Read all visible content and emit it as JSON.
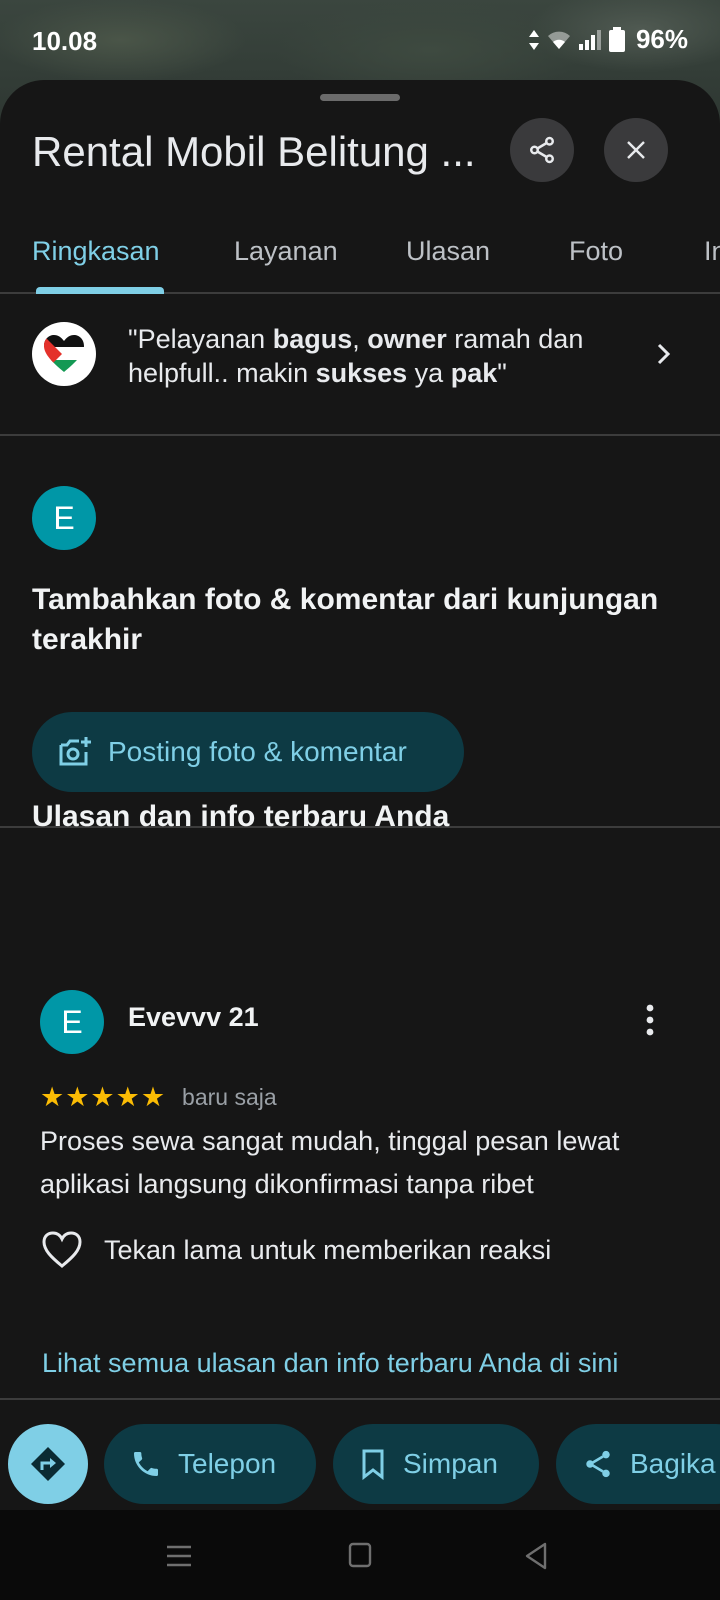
{
  "status_bar": {
    "time": "10.08",
    "battery": "96%"
  },
  "place": {
    "title": "Rental Mobil Belitung ..."
  },
  "tabs": [
    {
      "label": "Ringkasan",
      "active": true
    },
    {
      "label": "Layanan",
      "active": false
    },
    {
      "label": "Ulasan",
      "active": false
    },
    {
      "label": "Foto",
      "active": false
    },
    {
      "label": "In",
      "active": false
    }
  ],
  "highlight_quote": {
    "parts": [
      {
        "text": "\"Pelayanan ",
        "bold": false
      },
      {
        "text": "bagus",
        "bold": true
      },
      {
        "text": ", ",
        "bold": false
      },
      {
        "text": "owner",
        "bold": true
      },
      {
        "text": " ramah dan helpfull.. makin ",
        "bold": false
      },
      {
        "text": "sukses",
        "bold": true
      },
      {
        "text": " ya ",
        "bold": false
      },
      {
        "text": "pak",
        "bold": true
      },
      {
        "text": "\"",
        "bold": false
      }
    ]
  },
  "add_contribution": {
    "avatar_letter": "E",
    "heading": "Tambahkan foto & komentar dari kunjungan terakhir",
    "button_label": "Posting foto & komentar"
  },
  "recent": {
    "heading": "Ulasan dan info terbaru Anda",
    "review": {
      "avatar_letter": "E",
      "author": "Evevvv 21",
      "stars": "★★★★★",
      "rating": 5,
      "time_ago": "baru saja",
      "text": "Proses sewa sangat mudah, tinggal pesan lewat aplikasi langsung dikonfirmasi tanpa ribet",
      "reaction_hint": "Tekan lama untuk memberikan reaksi"
    },
    "see_all_link": "Lihat semua ulasan dan info terbaru Anda di sini"
  },
  "actions": {
    "call_label": "Telepon",
    "save_label": "Simpan",
    "share_label": "Bagika"
  },
  "colors": {
    "accent": "#7fcfe6",
    "button_bg": "#0d3a44",
    "avatar": "#0097a7",
    "star": "#fbbc04",
    "sheet_bg": "#161616"
  }
}
